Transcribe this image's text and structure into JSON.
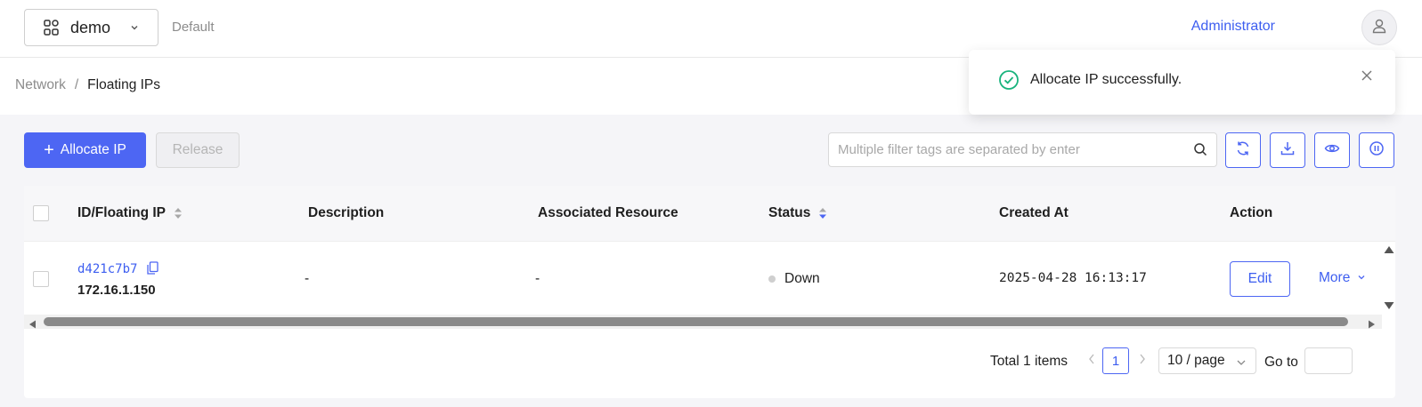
{
  "header": {
    "project_name": "demo",
    "domain": "Default",
    "user": "Administrator"
  },
  "breadcrumb": {
    "root": "Network",
    "separator": "/",
    "current": "Floating IPs"
  },
  "toolbar": {
    "allocate_label": "Allocate IP",
    "release_label": "Release",
    "search_placeholder": "Multiple filter tags are separated by enter",
    "icon_buttons": [
      "refresh-icon",
      "download-icon",
      "eye-icon",
      "pause-icon"
    ]
  },
  "table": {
    "columns": [
      "ID/Floating IP",
      "Description",
      "Associated Resource",
      "Status",
      "Created At",
      "Action"
    ],
    "rows": [
      {
        "id": "d421c7b7",
        "ip": "172.16.1.150",
        "description": "-",
        "associated_resource": "-",
        "status": "Down",
        "created_at": "2025-04-28 16:13:17",
        "edit_label": "Edit",
        "more_label": "More"
      }
    ]
  },
  "pagination": {
    "total": "Total 1 items",
    "current_page": "1",
    "page_size": "10 / page",
    "goto_label": "Go to"
  },
  "toast": {
    "message": "Allocate IP successfully."
  },
  "colors": {
    "primary": "#4d66f3",
    "link": "#3d5ef0",
    "success": "#19b37d",
    "status_down": "#cfcfcf"
  }
}
